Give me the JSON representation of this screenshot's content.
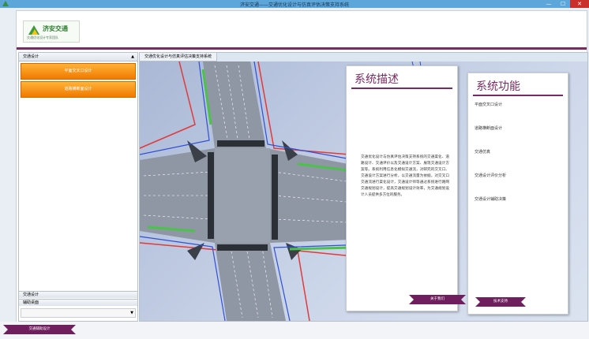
{
  "window": {
    "title": "济安交通——交通优化设计与仿真评估决策支持系统",
    "controls": {
      "minimize": "—",
      "maximize": "☐",
      "close": "✕"
    }
  },
  "header": {
    "logo": {
      "name": "济安交通",
      "tagline": "交通优化设计专家团队"
    }
  },
  "sidebar": {
    "header": "交通设计",
    "collapse_glyph": "▲",
    "buttons": [
      {
        "label": "平面交叉口设计"
      },
      {
        "label": "道路横断面设计"
      }
    ],
    "sections": [
      {
        "label": "交通设计"
      },
      {
        "label": "辅助桌面"
      }
    ],
    "scroll_glyph": "▼"
  },
  "map_panel": {
    "tab_label": "交通优化设计与仿真评估决策支持系统"
  },
  "desc_card": {
    "title": "系统描述",
    "body": "交通优化设计与仿真评估决策支持系统的交通渠化、道路设计、交通评价以及交通设计方案、展现交通设计方案等。系统利用信息化模拟交通流，对研究的交叉口、交通设计方案进行分析，以交通流量为依据，对交叉口交通流进行渠化设计，交通设计师等通过系统进行路网交通规划设计，提高交通规划设计效率，为交通规划设计人员提供多方位的服务。",
    "button_label": "关于我们"
  },
  "func_card": {
    "title": "系统功能",
    "items": [
      {
        "label": "平面交叉口设计"
      },
      {
        "label": "道路横断面设计"
      },
      {
        "label": "交通仿真"
      },
      {
        "label": "交通设计评价分析"
      },
      {
        "label": "交通设计辅助决策"
      }
    ],
    "button_label": "技术支持"
  },
  "footer": {
    "ribbon_label": "交通辅助设计"
  },
  "colors": {
    "accent": "#7a2a62",
    "orange": "#f07a00",
    "titlebar": "#5da6da",
    "road": "#8f96a4",
    "green_strip": "#4cc24c",
    "blue_line": "#2f4fd6",
    "red_line": "#e03a3a"
  }
}
